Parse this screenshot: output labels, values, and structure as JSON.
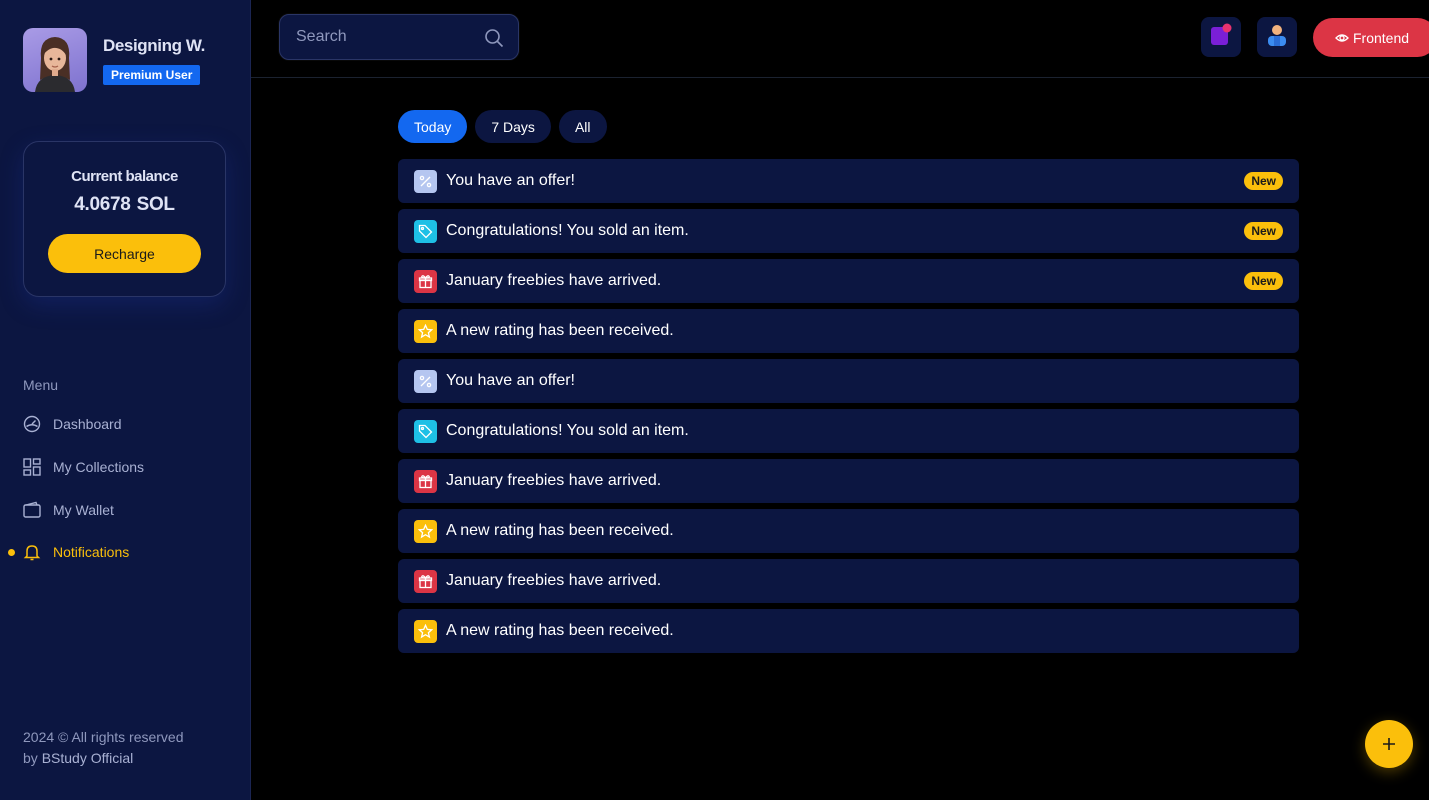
{
  "user": {
    "name": "Designing W.",
    "badge": "Premium User"
  },
  "balance": {
    "label": "Current balance",
    "amount": "4.0678",
    "unit": "SOL",
    "recharge_label": "Recharge"
  },
  "menu": {
    "title": "Menu",
    "items": [
      {
        "label": "Dashboard",
        "icon": "dashboard-icon"
      },
      {
        "label": "My Collections",
        "icon": "collections-icon"
      },
      {
        "label": "My Wallet",
        "icon": "wallet-icon"
      },
      {
        "label": "Notifications",
        "icon": "bell-icon",
        "active": true
      }
    ]
  },
  "footer": {
    "copyright": "2024 © All rights reserved",
    "by": "by",
    "brand": "BStudy Official"
  },
  "header": {
    "search_placeholder": "Search",
    "frontend_label": "Frontend"
  },
  "tabs": [
    {
      "label": "Today",
      "active": true
    },
    {
      "label": "7 Days",
      "active": false
    },
    {
      "label": "All",
      "active": false
    }
  ],
  "notifications": [
    {
      "type": "offer",
      "text": "You have an offer!",
      "badge": "New"
    },
    {
      "type": "tag",
      "text": "Congratulations! You sold an item.",
      "badge": "New"
    },
    {
      "type": "gift",
      "text": "January freebies have arrived.",
      "badge": "New"
    },
    {
      "type": "star",
      "text": "A new rating has been received.",
      "badge": ""
    },
    {
      "type": "offer",
      "text": "You have an offer!",
      "badge": ""
    },
    {
      "type": "tag",
      "text": "Congratulations! You sold an item.",
      "badge": ""
    },
    {
      "type": "gift",
      "text": "January freebies have arrived.",
      "badge": ""
    },
    {
      "type": "star",
      "text": "A new rating has been received.",
      "badge": ""
    },
    {
      "type": "gift",
      "text": "January freebies have arrived.",
      "badge": ""
    },
    {
      "type": "star",
      "text": "A new rating has been received.",
      "badge": ""
    }
  ],
  "colors": {
    "accent": "#fbbf0b",
    "primary": "#1368f0",
    "danger": "#dc3545",
    "sidebar": "#0c1641"
  }
}
